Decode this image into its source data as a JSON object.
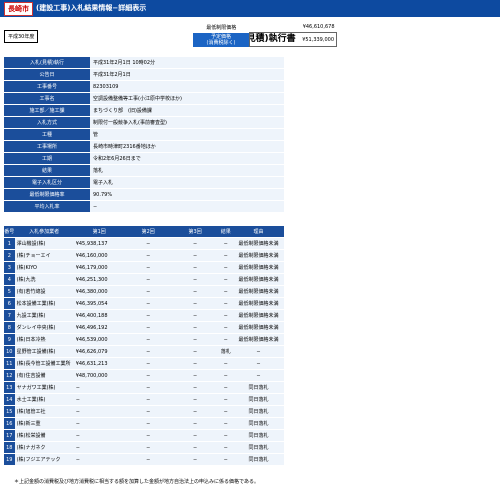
{
  "header": {
    "city": "長崎市",
    "title": "(建設工事)入札結果情報−詳細表示"
  },
  "year_badge": "平成30年度",
  "doc_title": "入札(見積)執行書",
  "prices": {
    "min_label": "最低制限価格",
    "min_value": "¥46,610,678",
    "planned_label": "予定価格\n(消費税除く)",
    "planned_value": "¥51,339,000"
  },
  "info": [
    {
      "label": "入札(見積)執行",
      "value": "平成31年2月1日 10時02分"
    },
    {
      "label": "公告日",
      "value": "平成31年2月1日"
    },
    {
      "label": "工事番号",
      "value": "82303109"
    },
    {
      "label": "工事名",
      "value": "空調設備整備等工事(小江原中学校ほか)"
    },
    {
      "label": "施工部／施工課",
      "value": "まちづくり部　(旧)設備課"
    },
    {
      "label": "入札方式",
      "value": "制限付一般競争入札(事前審査型)"
    },
    {
      "label": "工種",
      "value": "管"
    },
    {
      "label": "工事場所",
      "value": "長崎市時津町2316番地ほか"
    },
    {
      "label": "工期",
      "value": "令和2年6月26日まで"
    },
    {
      "label": "結果",
      "value": "落札"
    },
    {
      "label": "電子入札区分",
      "value": "電子入札"
    },
    {
      "label": "最低制限価格率",
      "value": "90.79%"
    },
    {
      "label": "平均入札率",
      "value": "−"
    }
  ],
  "bids_header": {
    "no": "番号",
    "name": "入札参加業者",
    "r1": "第1回",
    "r2": "第2回",
    "r3": "第3回",
    "result": "結果",
    "reason": "理由"
  },
  "bids": [
    {
      "no": "1",
      "name": "澤山機設(株)",
      "r1": "¥45,938,137",
      "r2": "−",
      "r3": "−",
      "result": "−",
      "reason": "最低制限価格未満"
    },
    {
      "no": "2",
      "name": "(株)チョーエイ",
      "r1": "¥46,160,000",
      "r2": "−",
      "r3": "−",
      "result": "−",
      "reason": "最低制限価格未満"
    },
    {
      "no": "3",
      "name": "(株)KIYO",
      "r1": "¥46,179,000",
      "r2": "−",
      "r3": "−",
      "result": "−",
      "reason": "最低制限価格未満"
    },
    {
      "no": "4",
      "name": "(株)九洗",
      "r1": "¥46,251,300",
      "r2": "−",
      "r3": "−",
      "result": "−",
      "reason": "最低制限価格未満"
    },
    {
      "no": "5",
      "name": "(有)若竹總設",
      "r1": "¥46,380,000",
      "r2": "−",
      "r3": "−",
      "result": "−",
      "reason": "最低制限価格未満"
    },
    {
      "no": "6",
      "name": "松本設備工業(株)",
      "r1": "¥46,395,054",
      "r2": "−",
      "r3": "−",
      "result": "−",
      "reason": "最低制限価格未満"
    },
    {
      "no": "7",
      "name": "九設工業(株)",
      "r1": "¥46,400,188",
      "r2": "−",
      "r3": "−",
      "result": "−",
      "reason": "最低制限価格未満"
    },
    {
      "no": "8",
      "name": "ダンレイ中央(株)",
      "r1": "¥46,496,192",
      "r2": "−",
      "r3": "−",
      "result": "−",
      "reason": "最低制限価格未満"
    },
    {
      "no": "9",
      "name": "(株)日本冷熱",
      "r1": "¥46,539,000",
      "r2": "−",
      "r3": "−",
      "result": "−",
      "reason": "最低制限価格未満"
    },
    {
      "no": "10",
      "name": "星野管工設備(株)",
      "r1": "¥46,626,079",
      "r2": "−",
      "r3": "−",
      "result": "落札",
      "reason": "−"
    },
    {
      "no": "11",
      "name": "(株)長今管工設備工業所",
      "r1": "¥46,631,213",
      "r2": "−",
      "r3": "−",
      "result": "−",
      "reason": "−"
    },
    {
      "no": "12",
      "name": "(有)住吉設備",
      "r1": "¥48,700,000",
      "r2": "−",
      "r3": "−",
      "result": "−",
      "reason": "−"
    },
    {
      "no": "13",
      "name": "ヤナガワ工業(株)",
      "r1": "−",
      "r2": "−",
      "r3": "−",
      "result": "−",
      "reason": "同日落札"
    },
    {
      "no": "14",
      "name": "水士工業(株)",
      "r1": "−",
      "r2": "−",
      "r3": "−",
      "result": "−",
      "reason": "同日落札"
    },
    {
      "no": "15",
      "name": "(株)旭管工社",
      "r1": "−",
      "r2": "−",
      "r3": "−",
      "result": "−",
      "reason": "同日落札"
    },
    {
      "no": "16",
      "name": "(株)新三重",
      "r1": "−",
      "r2": "−",
      "r3": "−",
      "result": "−",
      "reason": "同日落札"
    },
    {
      "no": "17",
      "name": "(株)松栄設備",
      "r1": "−",
      "r2": "−",
      "r3": "−",
      "result": "−",
      "reason": "同日落札"
    },
    {
      "no": "18",
      "name": "(株)ナガネク",
      "r1": "−",
      "r2": "−",
      "r3": "−",
      "result": "−",
      "reason": "同日落札"
    },
    {
      "no": "19",
      "name": "(株)フジエアテック",
      "r1": "−",
      "r2": "−",
      "r3": "−",
      "result": "−",
      "reason": "同日落札"
    }
  ],
  "footnote": "＊上記金額の消費税及び地方消費税に相当する額を加算した金額が地方自治法上の申込みに係る価格である。"
}
